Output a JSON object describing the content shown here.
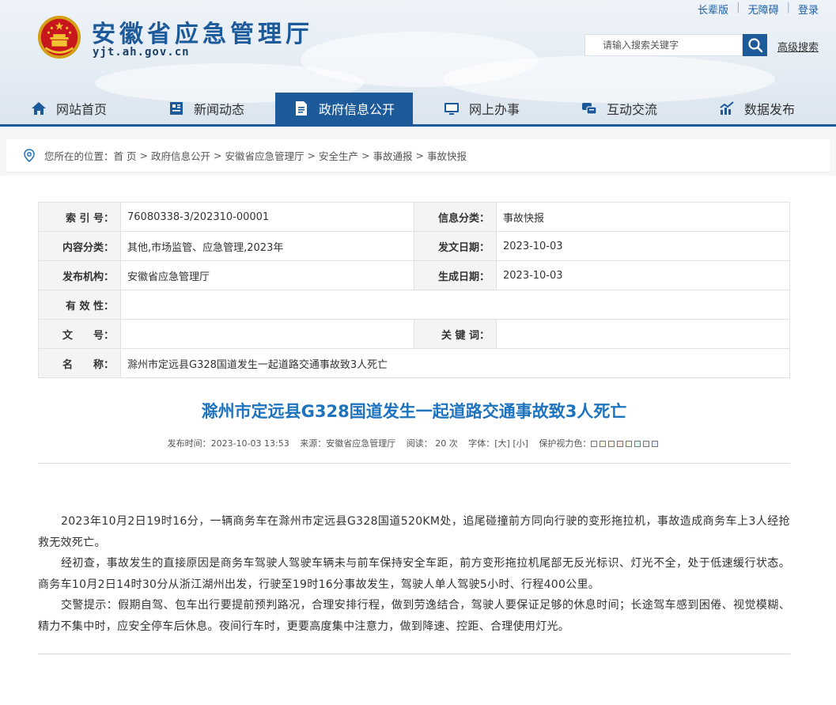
{
  "header": {
    "top_links": [
      "长辈版",
      "无障碍",
      "登录"
    ],
    "site_title": "安徽省应急管理厅",
    "site_domain": "yjt.ah.gov.cn",
    "search_placeholder": "请输入搜索关键字",
    "advanced_search": "高级搜索"
  },
  "nav": [
    {
      "label": "网站首页",
      "icon": "home-icon"
    },
    {
      "label": "新闻动态",
      "icon": "news-icon"
    },
    {
      "label": "政府信息公开",
      "icon": "document-icon",
      "active": true
    },
    {
      "label": "网上办事",
      "icon": "monitor-icon"
    },
    {
      "label": "互动交流",
      "icon": "chat-icon"
    },
    {
      "label": "数据发布",
      "icon": "chart-icon"
    }
  ],
  "breadcrumb": {
    "prefix": "您所在的位置：",
    "items": [
      "首 页",
      "政府信息公开",
      "安徽省应急管理厅",
      "安全生产",
      "事故通报",
      "事故快报"
    ],
    "separator": ">"
  },
  "info": {
    "index_label": "索 引 号：",
    "index_value": "76080338-3/202310-00001",
    "category_label": "信息分类：",
    "category_value": "事故快报",
    "content_label": "内容分类：",
    "content_value": "其他,市场监管、应急管理,2023年",
    "date_label": "发文日期：",
    "date_value": "2023-10-03",
    "org_label": "发布机构：",
    "org_value": "安徽省应急管理厅",
    "gen_label": "生成日期：",
    "gen_value": "2023-10-03",
    "valid_label": "有 效 性：",
    "valid_value": "",
    "doc_label": "文　　号：",
    "doc_value": "",
    "kw_label": "关 键 词：",
    "kw_value": "",
    "name_label": "名　　称：",
    "name_value": "滁州市定远县G328国道发生一起道路交通事故致3人死亡"
  },
  "article": {
    "title": "滁州市定远县G328国道发生一起道路交通事故致3人死亡",
    "meta_time": "发布时间：2023-10-03 13:53",
    "meta_source": "来源：安徽省应急管理厅",
    "meta_reads_label": "阅读：",
    "meta_reads": "20",
    "meta_reads_unit": "次",
    "meta_font_label": "字体：",
    "meta_font_big": "[大]",
    "meta_font_small": "[小]",
    "meta_eye_label": "保护视力色：",
    "eye_colors": [
      "#ffffff",
      "#faf9de",
      "#fff2e2",
      "#fde6e0",
      "#f3ffe1",
      "#dafaf3",
      "#eaeaef",
      "#e9ebfe"
    ],
    "paragraphs": [
      "2023年10月2日19时16分，一辆商务车在滁州市定远县G328国道520KM处，追尾碰撞前方同向行驶的变形拖拉机，事故造成商务车上3人经抢救无效死亡。",
      "经初查，事故发生的直接原因是商务车驾驶人驾驶车辆未与前车保持安全车距，前方变形拖拉机尾部无反光标识、灯光不全，处于低速缓行状态。商务车10月2日14时30分从浙江湖州出发，行驶至19时16分事故发生，驾驶人单人驾驶5小时、行程400公里。",
      "交警提示：假期自驾、包车出行要提前预判路况，合理安排行程，做到劳逸结合，驾驶人要保证足够的休息时间；长途驾车感到困倦、视觉模糊、精力不集中时，应安全停车后休息。夜间行车时，更要高度集中注意力，做到降速、控距、合理使用灯光。"
    ]
  },
  "colors": {
    "brand": "#1d5a9a",
    "title_blue": "#1e73be"
  }
}
